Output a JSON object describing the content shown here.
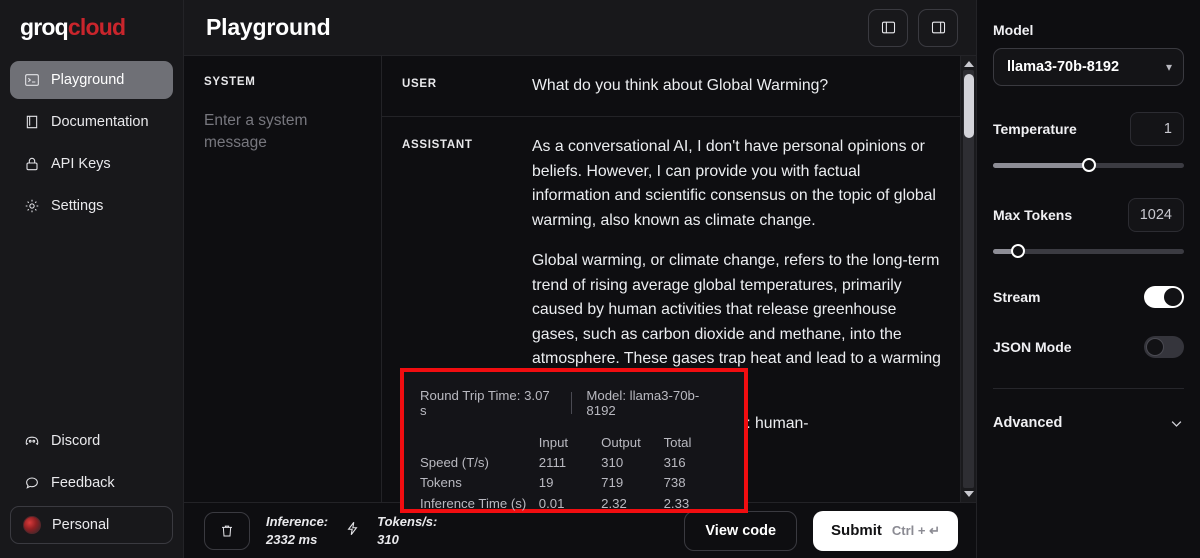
{
  "brand": {
    "name_part1": "groq",
    "name_part2": "cloud"
  },
  "sidebar": {
    "top_items": [
      {
        "label": "Playground",
        "icon": "terminal-icon",
        "active": true
      },
      {
        "label": "Documentation",
        "icon": "book-icon",
        "active": false
      },
      {
        "label": "API Keys",
        "icon": "lock-icon",
        "active": false
      },
      {
        "label": "Settings",
        "icon": "gear-icon",
        "active": false
      }
    ],
    "bottom_items": [
      {
        "label": "Discord",
        "icon": "discord-icon"
      },
      {
        "label": "Feedback",
        "icon": "chat-bubble-icon"
      },
      {
        "label": "Personal",
        "icon": "avatar-icon"
      }
    ]
  },
  "header": {
    "title": "Playground",
    "left_panel_toggle": "toggle-left-panel",
    "right_panel_toggle": "toggle-right-panel"
  },
  "system": {
    "label": "SYSTEM",
    "placeholder": "Enter a system message",
    "value": ""
  },
  "conversation": [
    {
      "role": "USER",
      "paragraphs": [
        "What do you think about Global Warming?"
      ]
    },
    {
      "role": "ASSISTANT",
      "paragraphs": [
        "As a conversational AI, I don't have personal opinions or beliefs. However, I can provide you with factual information and scientific consensus on the topic of global warming, also known as climate change.",
        "Global warming, or climate change, refers to the long-term trend of rising average global temperatures, primarily caused by human activities that release greenhouse gases, such as carbon dioxide and methane, into the atmosphere. These gases trap heat and lead to a warming effect on the planet.",
        "The scientific evidence is clear: human-"
      ]
    }
  ],
  "metrics_overlay": {
    "round_trip_time": "Round Trip Time: 3.07 s",
    "model": "Model: llama3-70b-8192",
    "columns": [
      "",
      "Input",
      "Output",
      "Total"
    ],
    "rows": [
      {
        "name": "Speed (T/s)",
        "input": "2111",
        "output": "310",
        "total": "316"
      },
      {
        "name": "Tokens",
        "input": "19",
        "output": "719",
        "total": "738"
      },
      {
        "name": "Inference Time (s)",
        "input": "0.01",
        "output": "2.32",
        "total": "2.33"
      }
    ],
    "highlight_color": "#f10d10"
  },
  "bottom_toolbar": {
    "clear_icon": "trash-icon",
    "inference_label": "Inference:",
    "inference_value": "2332 ms",
    "bolt_icon": "lightning-icon",
    "tokens_label": "Tokens/s:",
    "tokens_value": "310",
    "view_code_label": "View code",
    "submit_label": "Submit",
    "submit_shortcut": "Ctrl + ↵"
  },
  "settings": {
    "model": {
      "label": "Model",
      "value": "llama3-70b-8192",
      "chevron": "chevron-updown-icon"
    },
    "temperature": {
      "label": "Temperature",
      "value": "1",
      "percent": 50
    },
    "max_tokens": {
      "label": "Max Tokens",
      "value": "1024",
      "percent": 13
    },
    "stream": {
      "label": "Stream",
      "state": "on"
    },
    "json_mode": {
      "label": "JSON Mode",
      "state": "off"
    },
    "advanced": {
      "label": "Advanced",
      "chevron": "chevron-down-icon"
    }
  }
}
